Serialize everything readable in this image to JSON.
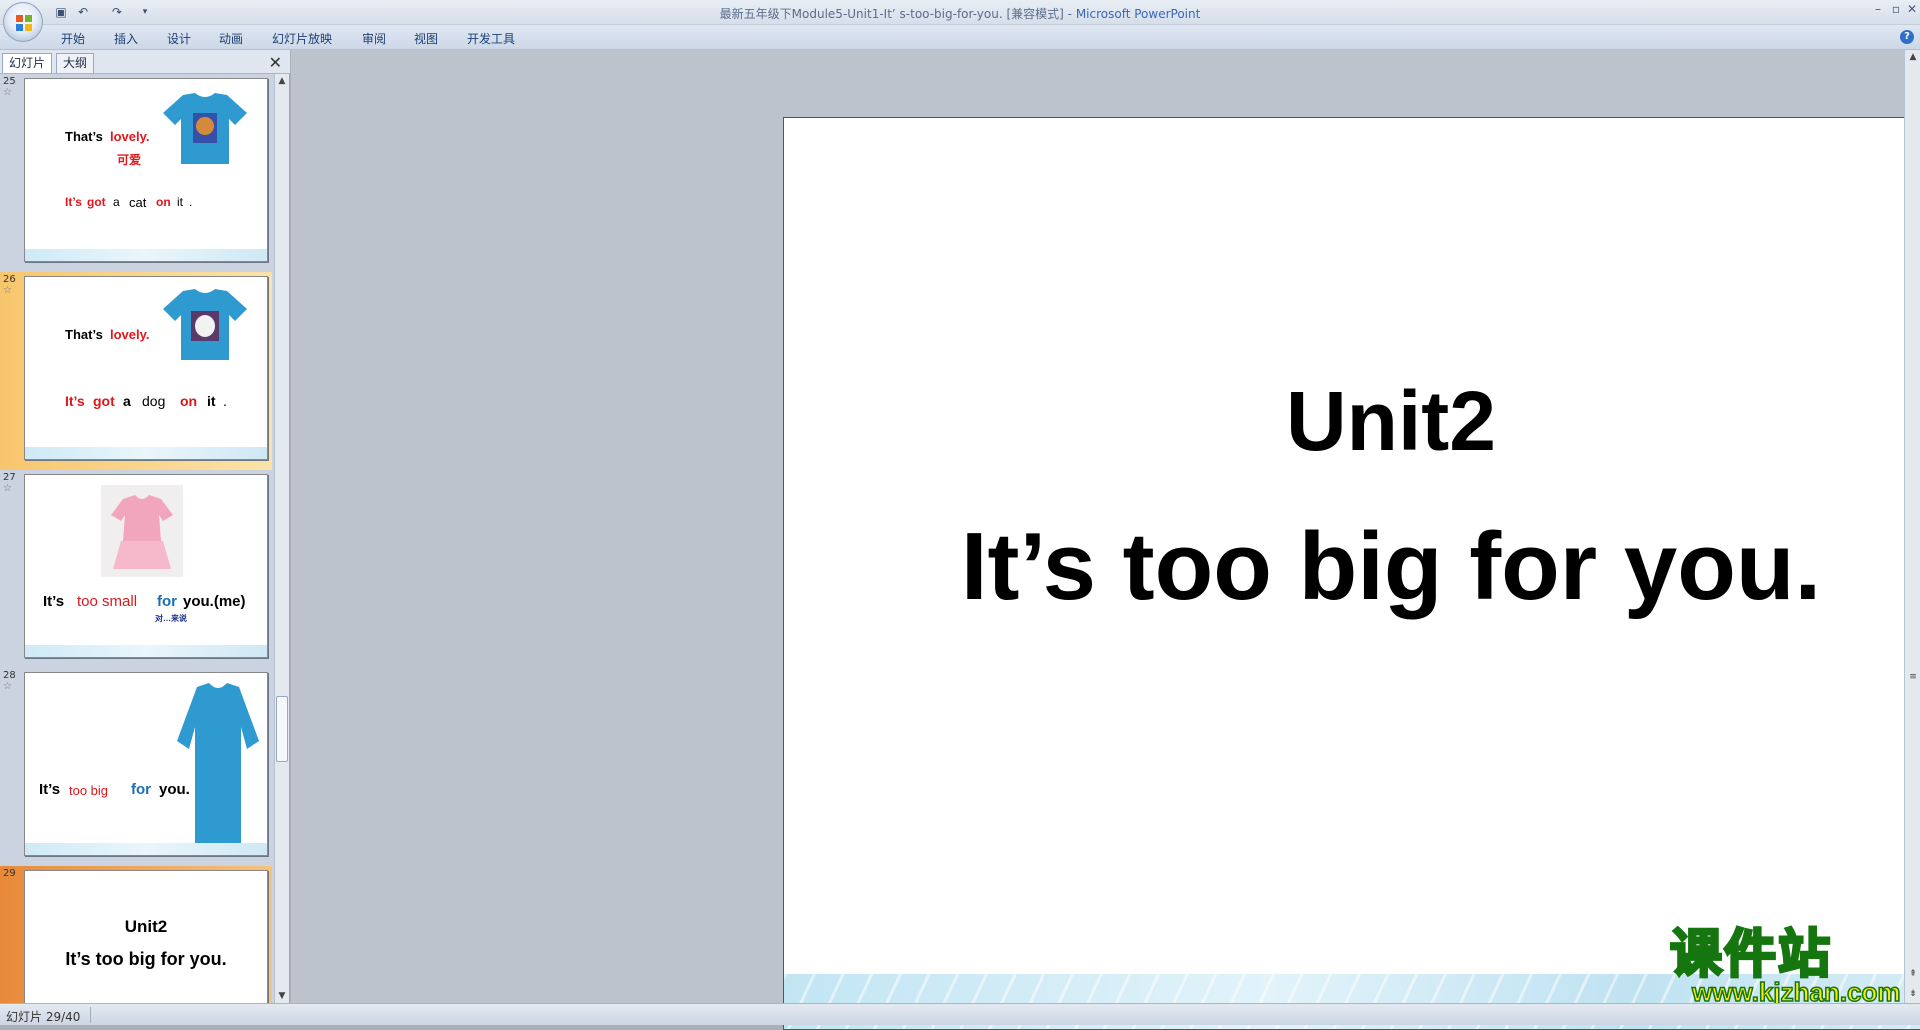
{
  "window": {
    "title_prefix": "最新五年级下Module5-Unit1-It’ s-too-big-for-you. [兼容模式]",
    "title_sep": " - ",
    "app_name": "Microsoft PowerPoint",
    "controls": [
      "–",
      "▫",
      "✕"
    ]
  },
  "quick_access": [
    "save-icon",
    "undo-icon",
    "redo-icon",
    "customize-icon"
  ],
  "ribbon_tabs": [
    "开始",
    "插入",
    "设计",
    "动画",
    "幻灯片放映",
    "审阅",
    "视图",
    "开发工具"
  ],
  "pane": {
    "tabs": [
      "幻灯片",
      "大纲"
    ],
    "close": "✕"
  },
  "thumbnails": [
    {
      "number": "25",
      "line1_a": "That’s",
      "line1_b": "lovely.",
      "cn": "可爱",
      "line2": [
        "It’s",
        "got",
        "a",
        "cat",
        "on",
        "it",
        "."
      ],
      "shirt_pic": "cat"
    },
    {
      "number": "26",
      "line1_a": "That’s",
      "line1_b": "lovely.",
      "line2": [
        "It’s",
        "got",
        "a",
        "dog",
        "on",
        "it",
        "."
      ],
      "shirt_pic": "dog"
    },
    {
      "number": "27",
      "line": [
        "It’s",
        "too small",
        "for",
        "you.(me)"
      ],
      "cn": "对…来说"
    },
    {
      "number": "28",
      "line": [
        "It’s",
        "too big",
        "for",
        "you."
      ]
    },
    {
      "number": "29",
      "title": "Unit2",
      "subtitle": "It’s too big for you."
    }
  ],
  "slide": {
    "title": "Unit2",
    "subtitle": "It’s too big for you."
  },
  "status": {
    "text": "幻灯片 29/40"
  },
  "watermark": {
    "main": "课件站",
    "url": "www.kjzhan.com"
  },
  "colors": {
    "accent_red": "#e0161b",
    "accent_blue": "#1e6eb7",
    "selection": "#f7c66c"
  }
}
